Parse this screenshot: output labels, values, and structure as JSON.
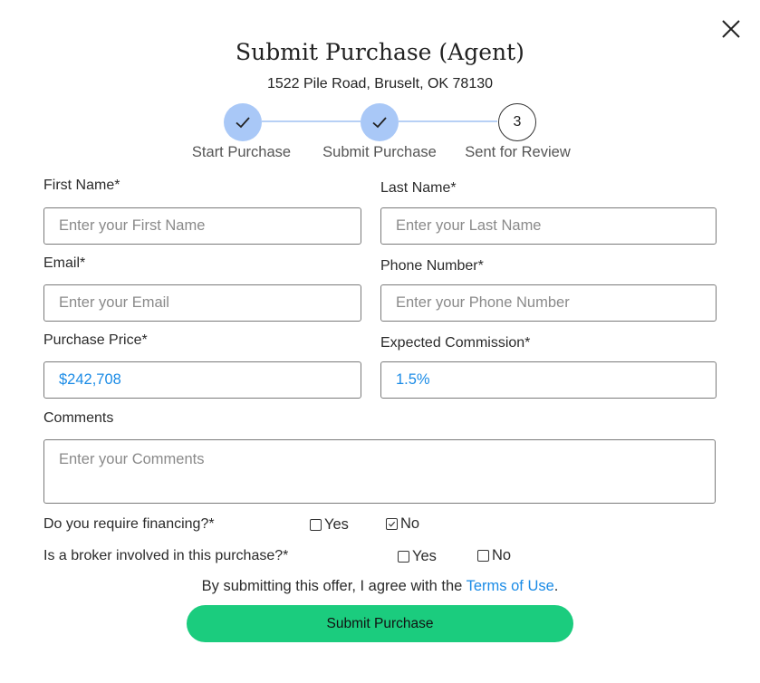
{
  "modal": {
    "title": "Submit Purchase (Agent)",
    "address": "1522 Pile Road, Bruselt, OK 78130"
  },
  "steps": [
    {
      "label": "Start Purchase",
      "state": "done"
    },
    {
      "label": "Submit Purchase",
      "state": "done"
    },
    {
      "label": "Sent for Review",
      "state": "todo",
      "number": "3"
    }
  ],
  "form": {
    "first_name": {
      "label": "First Name*",
      "placeholder": "Enter your First Name",
      "value": ""
    },
    "last_name": {
      "label": "Last Name*",
      "placeholder": "Enter your Last Name",
      "value": ""
    },
    "email": {
      "label": "Email*",
      "placeholder": "Enter your Email",
      "value": ""
    },
    "phone": {
      "label": "Phone Number*",
      "placeholder": "Enter your Phone Number",
      "value": ""
    },
    "purchase_price": {
      "label": "Purchase Price*",
      "value": "$242,708"
    },
    "commission": {
      "label": "Expected Commission*",
      "value": "1.5%"
    },
    "comments": {
      "label": "Comments",
      "placeholder": "Enter your Comments"
    },
    "financing": {
      "question": "Do you require financing?*",
      "yes_label": "Yes",
      "no_label": "No",
      "selected": "No"
    },
    "broker": {
      "question": "Is a broker involved in this purchase?*",
      "yes_label": "Yes",
      "no_label": "No",
      "selected": ""
    }
  },
  "terms": {
    "prefix": "By submitting this offer, I agree with the ",
    "link": "Terms of Use",
    "suffix": "."
  },
  "submit_label": "Submit Purchase",
  "colors": {
    "accent": "#1a8be6",
    "step_done": "#a9c8f7",
    "submit": "#1bcc7e"
  }
}
